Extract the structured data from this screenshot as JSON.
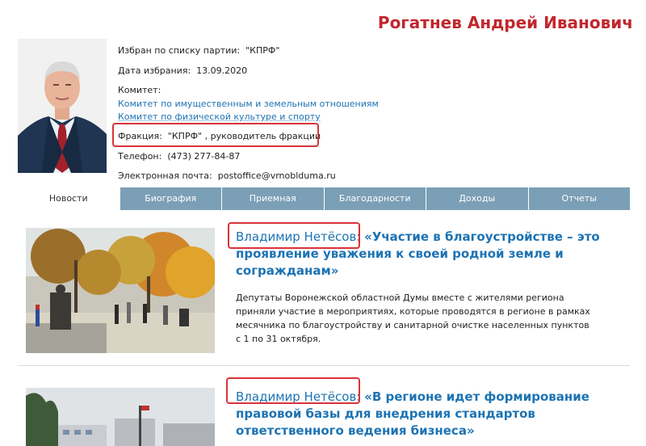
{
  "deputy": {
    "name": "Рогатнев Андрей Иванович",
    "party_label": "Избран по списку партии:",
    "party_value": "\"КПРФ\"",
    "date_label": "Дата избрания:",
    "date_value": "13.09.2020",
    "committee_label": "Комитет:",
    "committees": [
      "Комитет по имущественным и земельным отношениям",
      "Комитет по физической культуре и спорту"
    ],
    "faction_label": "Фракция:",
    "faction_value": "\"КПРФ\" , руководитель фракции",
    "phone_label": "Телефон:",
    "phone_value": "(473) 277-84-87",
    "email_label": "Электронная почта:",
    "email_value": "postoffice@vrnoblduma.ru"
  },
  "tabs": [
    "Новости",
    "Биография",
    "Приемная",
    "Благодарности",
    "Доходы",
    "Отчеты"
  ],
  "active_tab": "Новости",
  "news": [
    {
      "author": "Владимир Нетёсов:",
      "title": "«Участие в благоустройстве – это проявление уважения к своей родной земле и согражданам»",
      "text": "Депутаты Воронежской областной Думы вместе с жителями региона приняли участие в мероприятиях, которые проводятся в регионе в рамках месячника по благоустройству и санитарной очистке населенных пунктов с 1 по 31 октября."
    },
    {
      "author": "Владимир Нетёсов:",
      "title": "«В регионе идет формирование правовой базы для внедрения стандартов ответственного ведения бизнеса»",
      "text": ""
    }
  ],
  "colors": {
    "name": "#c1272d",
    "link": "#1d73b3",
    "tab_bg": "#7b9fb6",
    "highlight": "#d9333a"
  }
}
